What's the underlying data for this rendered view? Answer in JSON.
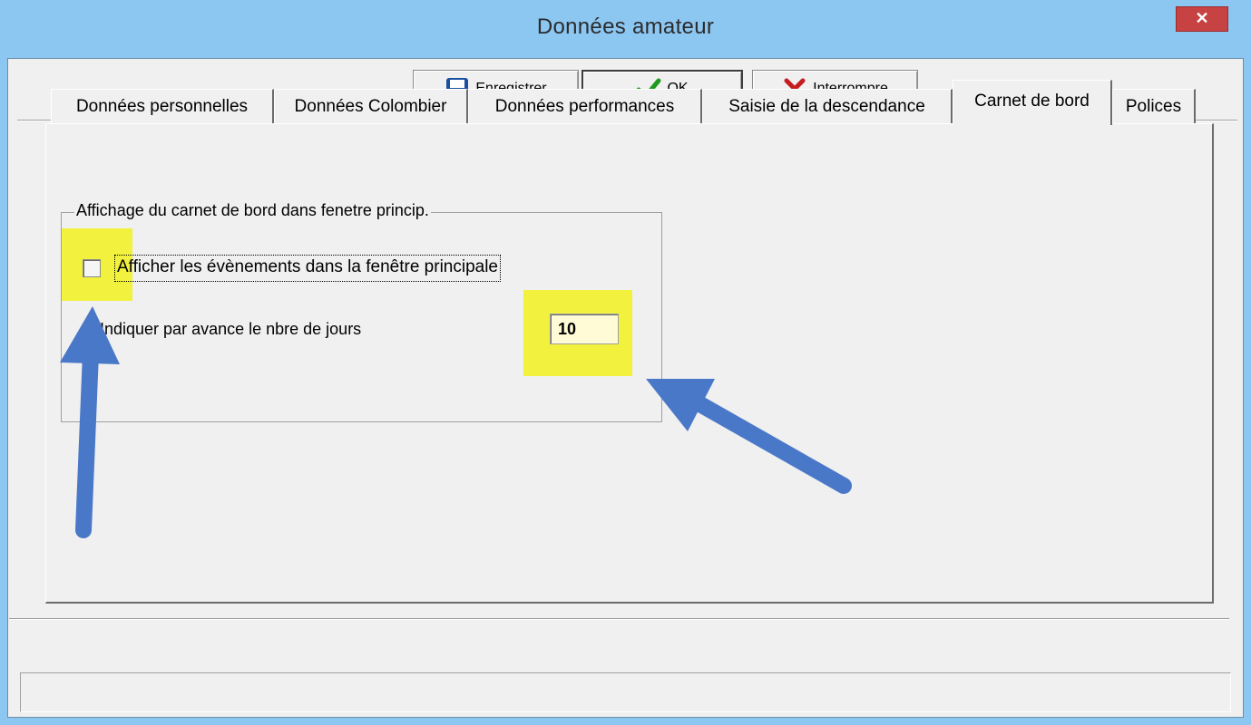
{
  "window": {
    "title": "Données amateur",
    "close_symbol": "✕"
  },
  "toolbar": {
    "save_label": "Enregistrer",
    "ok_label": "OK",
    "cancel_label": "Interrompre",
    "save_icon": "floppy-disk-icon",
    "ok_icon": "green-check-icon",
    "cancel_icon": "red-x-icon"
  },
  "tabs": [
    {
      "label": "Données personnelles",
      "active": false
    },
    {
      "label": "Données Colombier",
      "active": false
    },
    {
      "label": "Données performances",
      "active": false
    },
    {
      "label": "Saisie de la descendance",
      "active": false
    },
    {
      "label": "Carnet de bord",
      "active": true
    },
    {
      "label": "Polices",
      "active": false
    }
  ],
  "logbook": {
    "group_title": "Affichage du carnet de bord dans fenetre princip.",
    "show_events_label": "Afficher les évènements dans la fenêtre principale",
    "show_events_checked": false,
    "days_ahead_label": "Indiquer par avance le nbre de jours",
    "days_ahead_value": "10"
  },
  "annotations": {
    "highlight_color": "#f1f13e",
    "arrow_color": "#4a78c8"
  },
  "statusbar": {
    "text": ""
  }
}
